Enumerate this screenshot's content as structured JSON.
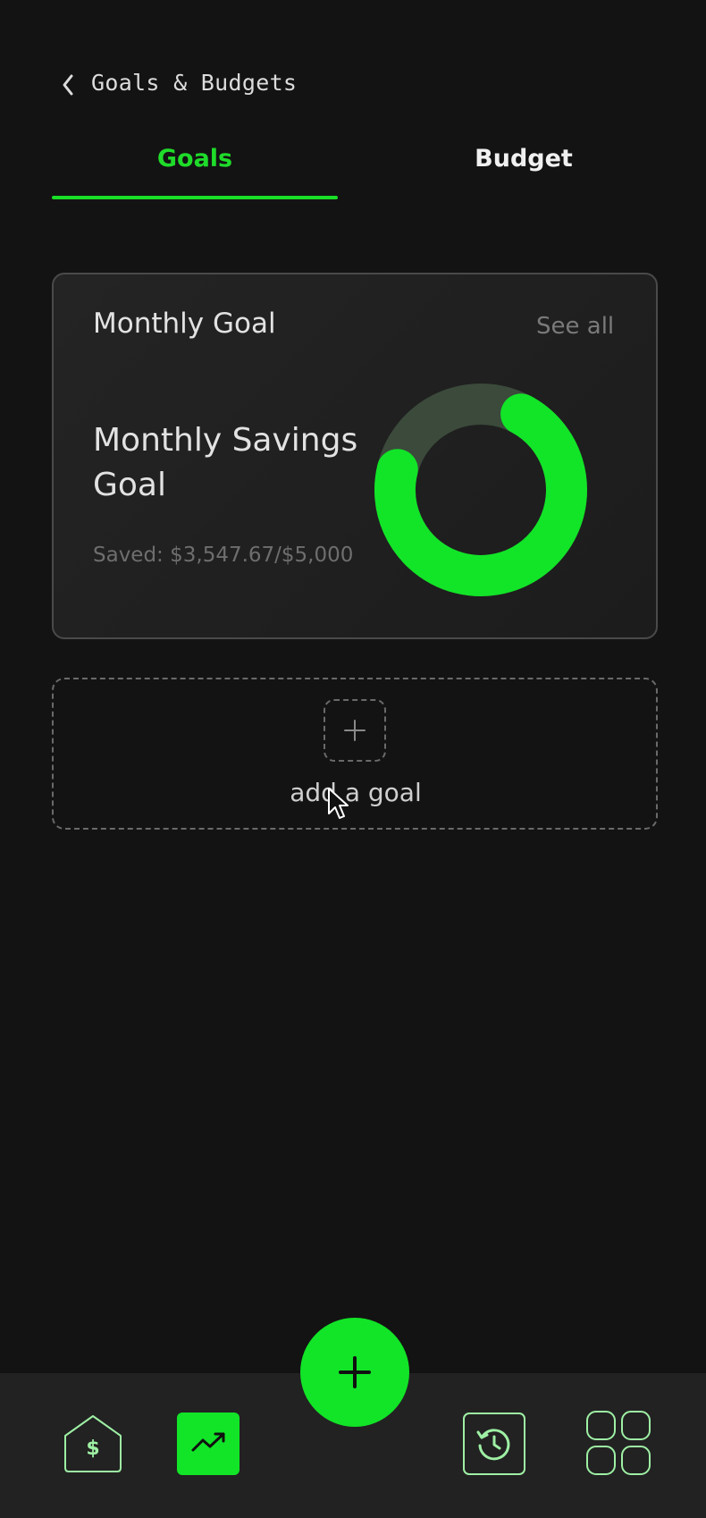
{
  "header": {
    "title": "Goals & Budgets",
    "back_icon": "chevron-left-icon"
  },
  "tabs": [
    {
      "label": "Goals",
      "active": true
    },
    {
      "label": "Budget",
      "active": false
    }
  ],
  "colors": {
    "accent": "#12e428",
    "background": "#131313",
    "card_border": "#4a4a4a",
    "ring_track": "#3a4a3a"
  },
  "goal_card": {
    "title": "Monthly Goal",
    "see_all": "See all",
    "goal_name": "Monthly Savings Goal",
    "saved_text": "Saved: $3,547.67/$5,000",
    "progress": 0.71
  },
  "add_goal": {
    "label": "add a goal",
    "icon": "plus-icon"
  },
  "fab": {
    "icon": "plus-icon"
  },
  "bottom_nav": [
    {
      "icon": "home-dollar-icon"
    },
    {
      "icon": "trending-up-icon",
      "active": true
    },
    {
      "icon": "history-icon"
    },
    {
      "icon": "apps-grid-icon"
    }
  ]
}
